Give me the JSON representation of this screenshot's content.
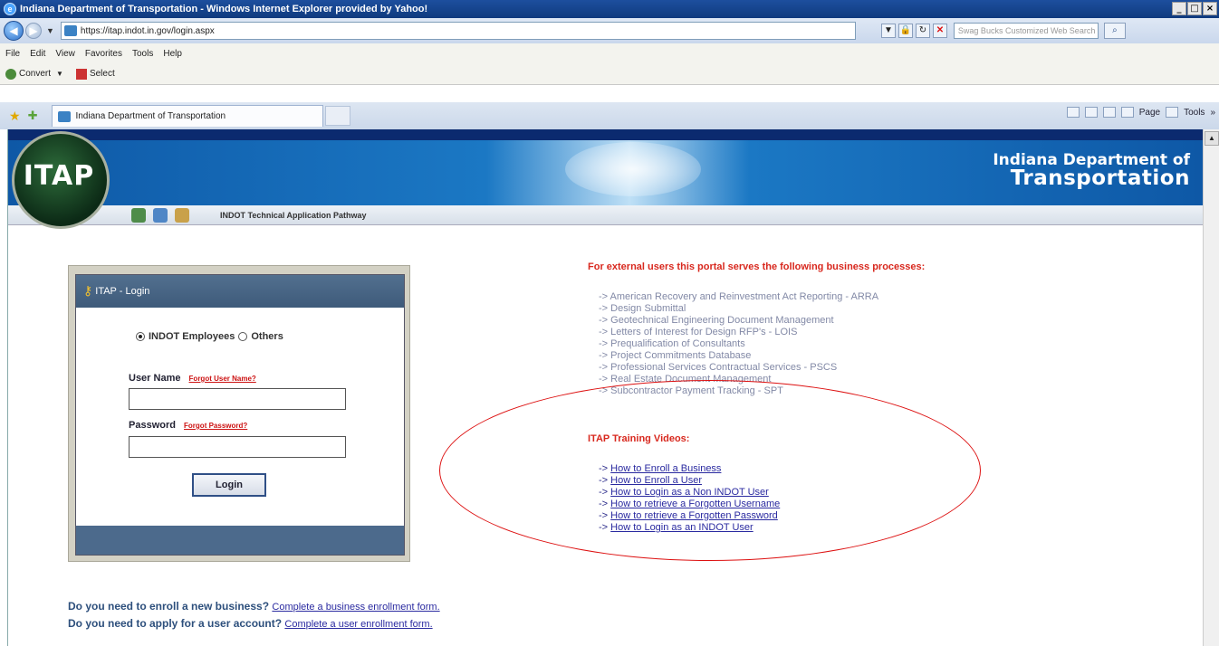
{
  "window": {
    "title": "Indiana Department of Transportation - Windows Internet Explorer provided by Yahoo!",
    "address": "https://itap.indot.in.gov/login.aspx",
    "search_placeholder": "Swag Bucks Customized Web Search"
  },
  "menu": [
    "File",
    "Edit",
    "View",
    "Favorites",
    "Tools",
    "Help"
  ],
  "toolbar": {
    "convert": "Convert",
    "select": "Select"
  },
  "tabs": {
    "active": "Indiana Department of Transportation"
  },
  "commandbar": {
    "page": "Page",
    "tools": "Tools"
  },
  "header": {
    "badge": "ITAP",
    "org_line1": "Indiana Department of",
    "org_line2": "Transportation",
    "subtitle": "INDOT Technical Application Pathway"
  },
  "login": {
    "title": "ITAP - Login",
    "radio_indot": "INDOT Employees",
    "radio_others": "Others",
    "username_label": "User Name",
    "forgot_username": "Forgot User Name?",
    "password_label": "Password",
    "forgot_password": "Forgot Password?",
    "login_button": "Login"
  },
  "right": {
    "heading": "For external users this portal serves the following business processes:",
    "processes": [
      "-> American Recovery and Reinvestment Act Reporting - ARRA",
      "-> Design Submittal",
      "-> Geotechnical Engineering Document Management",
      "-> Letters of Interest for Design RFP's - LOIS",
      "-> Prequalification of Consultants",
      "-> Project Commitments Database",
      "-> Professional Services Contractual Services - PSCS",
      "-> Real Estate Document Management",
      "-> Subcontractor Payment Tracking - SPT"
    ],
    "videos_heading": "ITAP Training Videos:",
    "videos": [
      "How to Enroll a Business",
      "How to Enroll a User",
      "How to Login as a Non INDOT User",
      "How to retrieve a Forgotten Username",
      "How to retrieve a Forgotten Password",
      "How to Login as an INDOT User"
    ],
    "arrow": "->"
  },
  "bottom": {
    "q1": "Do you need to enroll a new business?",
    "link1": "Complete a business enrollment form.",
    "q2": "Do you need to apply for a user account?",
    "link2": "Complete a user enrollment form."
  }
}
